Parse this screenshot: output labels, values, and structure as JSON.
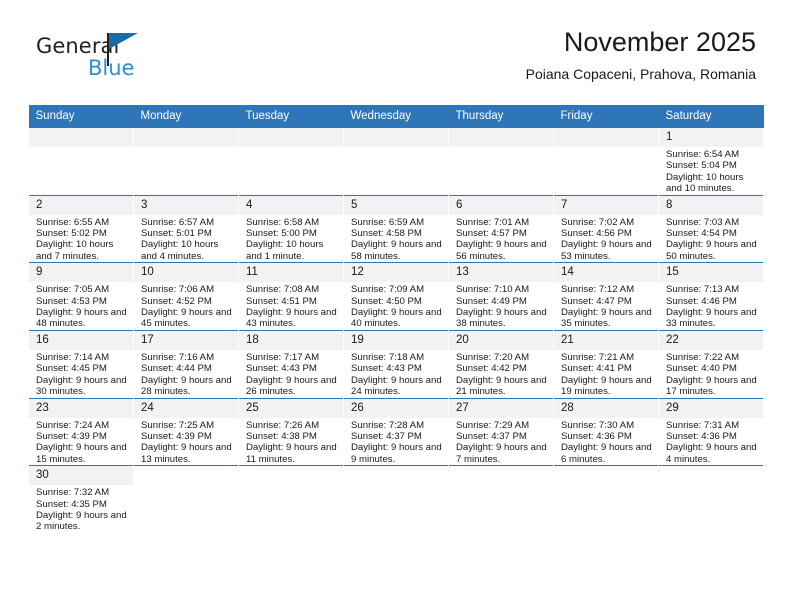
{
  "brand": {
    "name_part1": "General",
    "name_part2": "Blue",
    "flag_color": "#1b6ca8",
    "blue_text_color": "#2b8ed6"
  },
  "header": {
    "title": "November 2025",
    "subtitle": "Poiana Copaceni, Prahova, Romania",
    "header_bg_color": "#2e76b8"
  },
  "weekdays": [
    "Sunday",
    "Monday",
    "Tuesday",
    "Wednesday",
    "Thursday",
    "Friday",
    "Saturday"
  ],
  "labels": {
    "sunrise": "Sunrise:",
    "sunset": "Sunset:",
    "daylight": "Daylight:"
  },
  "weeks": [
    [
      {
        "day": "",
        "sunrise": "",
        "sunset": "",
        "daylight": "",
        "empty": true
      },
      {
        "day": "",
        "sunrise": "",
        "sunset": "",
        "daylight": "",
        "empty": true
      },
      {
        "day": "",
        "sunrise": "",
        "sunset": "",
        "daylight": "",
        "empty": true
      },
      {
        "day": "",
        "sunrise": "",
        "sunset": "",
        "daylight": "",
        "empty": true
      },
      {
        "day": "",
        "sunrise": "",
        "sunset": "",
        "daylight": "",
        "empty": true
      },
      {
        "day": "",
        "sunrise": "",
        "sunset": "",
        "daylight": "",
        "empty": true
      },
      {
        "day": "1",
        "sunrise": "Sunrise: 6:54 AM",
        "sunset": "Sunset: 5:04 PM",
        "daylight": "Daylight: 10 hours and 10 minutes."
      }
    ],
    [
      {
        "day": "2",
        "sunrise": "Sunrise: 6:55 AM",
        "sunset": "Sunset: 5:02 PM",
        "daylight": "Daylight: 10 hours and 7 minutes."
      },
      {
        "day": "3",
        "sunrise": "Sunrise: 6:57 AM",
        "sunset": "Sunset: 5:01 PM",
        "daylight": "Daylight: 10 hours and 4 minutes."
      },
      {
        "day": "4",
        "sunrise": "Sunrise: 6:58 AM",
        "sunset": "Sunset: 5:00 PM",
        "daylight": "Daylight: 10 hours and 1 minute."
      },
      {
        "day": "5",
        "sunrise": "Sunrise: 6:59 AM",
        "sunset": "Sunset: 4:58 PM",
        "daylight": "Daylight: 9 hours and 58 minutes."
      },
      {
        "day": "6",
        "sunrise": "Sunrise: 7:01 AM",
        "sunset": "Sunset: 4:57 PM",
        "daylight": "Daylight: 9 hours and 56 minutes."
      },
      {
        "day": "7",
        "sunrise": "Sunrise: 7:02 AM",
        "sunset": "Sunset: 4:56 PM",
        "daylight": "Daylight: 9 hours and 53 minutes."
      },
      {
        "day": "8",
        "sunrise": "Sunrise: 7:03 AM",
        "sunset": "Sunset: 4:54 PM",
        "daylight": "Daylight: 9 hours and 50 minutes."
      }
    ],
    [
      {
        "day": "9",
        "sunrise": "Sunrise: 7:05 AM",
        "sunset": "Sunset: 4:53 PM",
        "daylight": "Daylight: 9 hours and 48 minutes."
      },
      {
        "day": "10",
        "sunrise": "Sunrise: 7:06 AM",
        "sunset": "Sunset: 4:52 PM",
        "daylight": "Daylight: 9 hours and 45 minutes."
      },
      {
        "day": "11",
        "sunrise": "Sunrise: 7:08 AM",
        "sunset": "Sunset: 4:51 PM",
        "daylight": "Daylight: 9 hours and 43 minutes."
      },
      {
        "day": "12",
        "sunrise": "Sunrise: 7:09 AM",
        "sunset": "Sunset: 4:50 PM",
        "daylight": "Daylight: 9 hours and 40 minutes."
      },
      {
        "day": "13",
        "sunrise": "Sunrise: 7:10 AM",
        "sunset": "Sunset: 4:49 PM",
        "daylight": "Daylight: 9 hours and 38 minutes."
      },
      {
        "day": "14",
        "sunrise": "Sunrise: 7:12 AM",
        "sunset": "Sunset: 4:47 PM",
        "daylight": "Daylight: 9 hours and 35 minutes."
      },
      {
        "day": "15",
        "sunrise": "Sunrise: 7:13 AM",
        "sunset": "Sunset: 4:46 PM",
        "daylight": "Daylight: 9 hours and 33 minutes."
      }
    ],
    [
      {
        "day": "16",
        "sunrise": "Sunrise: 7:14 AM",
        "sunset": "Sunset: 4:45 PM",
        "daylight": "Daylight: 9 hours and 30 minutes."
      },
      {
        "day": "17",
        "sunrise": "Sunrise: 7:16 AM",
        "sunset": "Sunset: 4:44 PM",
        "daylight": "Daylight: 9 hours and 28 minutes."
      },
      {
        "day": "18",
        "sunrise": "Sunrise: 7:17 AM",
        "sunset": "Sunset: 4:43 PM",
        "daylight": "Daylight: 9 hours and 26 minutes."
      },
      {
        "day": "19",
        "sunrise": "Sunrise: 7:18 AM",
        "sunset": "Sunset: 4:43 PM",
        "daylight": "Daylight: 9 hours and 24 minutes."
      },
      {
        "day": "20",
        "sunrise": "Sunrise: 7:20 AM",
        "sunset": "Sunset: 4:42 PM",
        "daylight": "Daylight: 9 hours and 21 minutes."
      },
      {
        "day": "21",
        "sunrise": "Sunrise: 7:21 AM",
        "sunset": "Sunset: 4:41 PM",
        "daylight": "Daylight: 9 hours and 19 minutes."
      },
      {
        "day": "22",
        "sunrise": "Sunrise: 7:22 AM",
        "sunset": "Sunset: 4:40 PM",
        "daylight": "Daylight: 9 hours and 17 minutes."
      }
    ],
    [
      {
        "day": "23",
        "sunrise": "Sunrise: 7:24 AM",
        "sunset": "Sunset: 4:39 PM",
        "daylight": "Daylight: 9 hours and 15 minutes."
      },
      {
        "day": "24",
        "sunrise": "Sunrise: 7:25 AM",
        "sunset": "Sunset: 4:39 PM",
        "daylight": "Daylight: 9 hours and 13 minutes."
      },
      {
        "day": "25",
        "sunrise": "Sunrise: 7:26 AM",
        "sunset": "Sunset: 4:38 PM",
        "daylight": "Daylight: 9 hours and 11 minutes."
      },
      {
        "day": "26",
        "sunrise": "Sunrise: 7:28 AM",
        "sunset": "Sunset: 4:37 PM",
        "daylight": "Daylight: 9 hours and 9 minutes."
      },
      {
        "day": "27",
        "sunrise": "Sunrise: 7:29 AM",
        "sunset": "Sunset: 4:37 PM",
        "daylight": "Daylight: 9 hours and 7 minutes."
      },
      {
        "day": "28",
        "sunrise": "Sunrise: 7:30 AM",
        "sunset": "Sunset: 4:36 PM",
        "daylight": "Daylight: 9 hours and 6 minutes."
      },
      {
        "day": "29",
        "sunrise": "Sunrise: 7:31 AM",
        "sunset": "Sunset: 4:36 PM",
        "daylight": "Daylight: 9 hours and 4 minutes."
      }
    ],
    [
      {
        "day": "30",
        "sunrise": "Sunrise: 7:32 AM",
        "sunset": "Sunset: 4:35 PM",
        "daylight": "Daylight: 9 hours and 2 minutes."
      },
      {
        "day": "",
        "sunrise": "",
        "sunset": "",
        "daylight": "",
        "blank": true
      },
      {
        "day": "",
        "sunrise": "",
        "sunset": "",
        "daylight": "",
        "blank": true
      },
      {
        "day": "",
        "sunrise": "",
        "sunset": "",
        "daylight": "",
        "blank": true
      },
      {
        "day": "",
        "sunrise": "",
        "sunset": "",
        "daylight": "",
        "blank": true
      },
      {
        "day": "",
        "sunrise": "",
        "sunset": "",
        "daylight": "",
        "blank": true
      },
      {
        "day": "",
        "sunrise": "",
        "sunset": "",
        "daylight": "",
        "blank": true
      }
    ]
  ]
}
